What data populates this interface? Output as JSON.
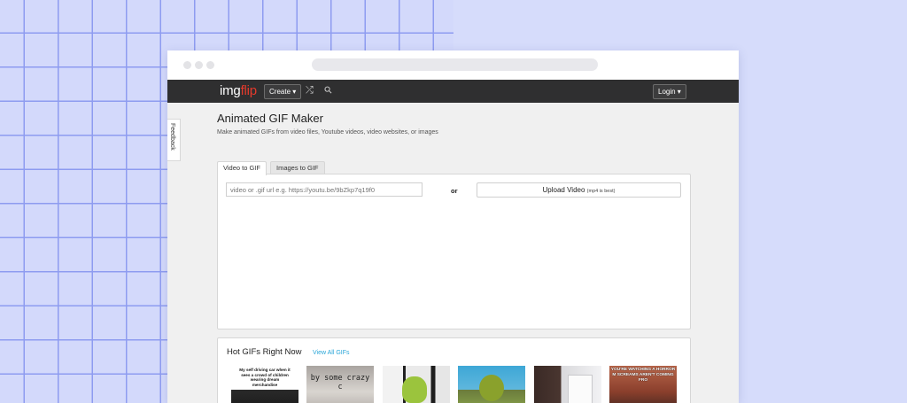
{
  "app": {
    "logo_part1": "img",
    "logo_part2": "flip",
    "create_label": "Create ▾",
    "login_label": "Login ▾",
    "shuffle_icon": "⤮",
    "search_icon": "⚲"
  },
  "feedback_label": "Feedback",
  "page": {
    "title": "Animated GIF Maker",
    "subtitle": "Make animated GIFs from video files, Youtube videos, video websites, or images"
  },
  "tabs": [
    {
      "label": "Video to GIF",
      "active": true
    },
    {
      "label": "Images to GIF",
      "active": false
    }
  ],
  "panel": {
    "url_placeholder": "video or .gif url e.g. https://youtu.be/9bZkp7q19f0",
    "or_label": "or",
    "upload_label": "Upload Video",
    "upload_note": "(mp4 is best)"
  },
  "hot": {
    "title": "Hot GIFs Right Now",
    "view_all": "View All GIFs",
    "thumb_captions": [
      "My self driving car when it sees a crowd of children wearing dream merchandise",
      "by some crazy c",
      "",
      "",
      "",
      "YOU'RE WATCHING A HORROR M SCREAMS AREN'T COMING FRO"
    ]
  }
}
